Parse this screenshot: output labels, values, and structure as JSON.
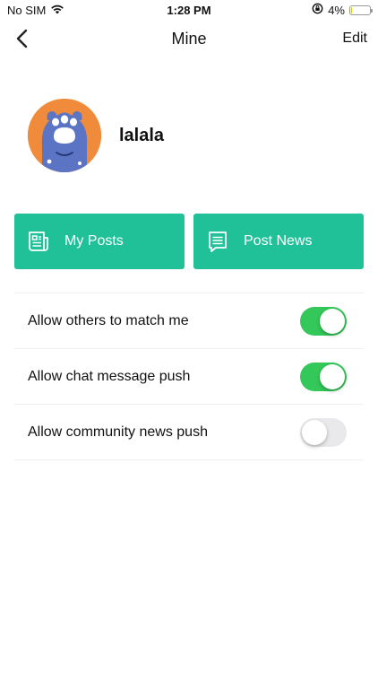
{
  "status_bar": {
    "carrier": "No SIM",
    "time": "1:28 PM",
    "battery_text": "4%",
    "battery_level": 0.04,
    "icons": [
      "wifi-icon",
      "orientation-lock-icon",
      "battery-icon"
    ]
  },
  "nav": {
    "back_icon": "chevron-left-icon",
    "title": "Mine",
    "edit_label": "Edit"
  },
  "profile": {
    "avatar_icon": "cat-paw-avatar",
    "username": "lalala"
  },
  "actions": [
    {
      "icon": "document-icon",
      "label": "My Posts"
    },
    {
      "icon": "message-icon",
      "label": "Post News"
    }
  ],
  "settings": [
    {
      "label": "Allow others to match me",
      "enabled": true
    },
    {
      "label": "Allow chat message push",
      "enabled": true
    },
    {
      "label": "Allow community news push",
      "enabled": false
    }
  ],
  "colors": {
    "accent": "#20c199",
    "toggle_on": "#34c759",
    "toggle_off": "#e9e9eb",
    "avatar_bg": "#ef8b3a",
    "paw": "#5b74c4"
  }
}
